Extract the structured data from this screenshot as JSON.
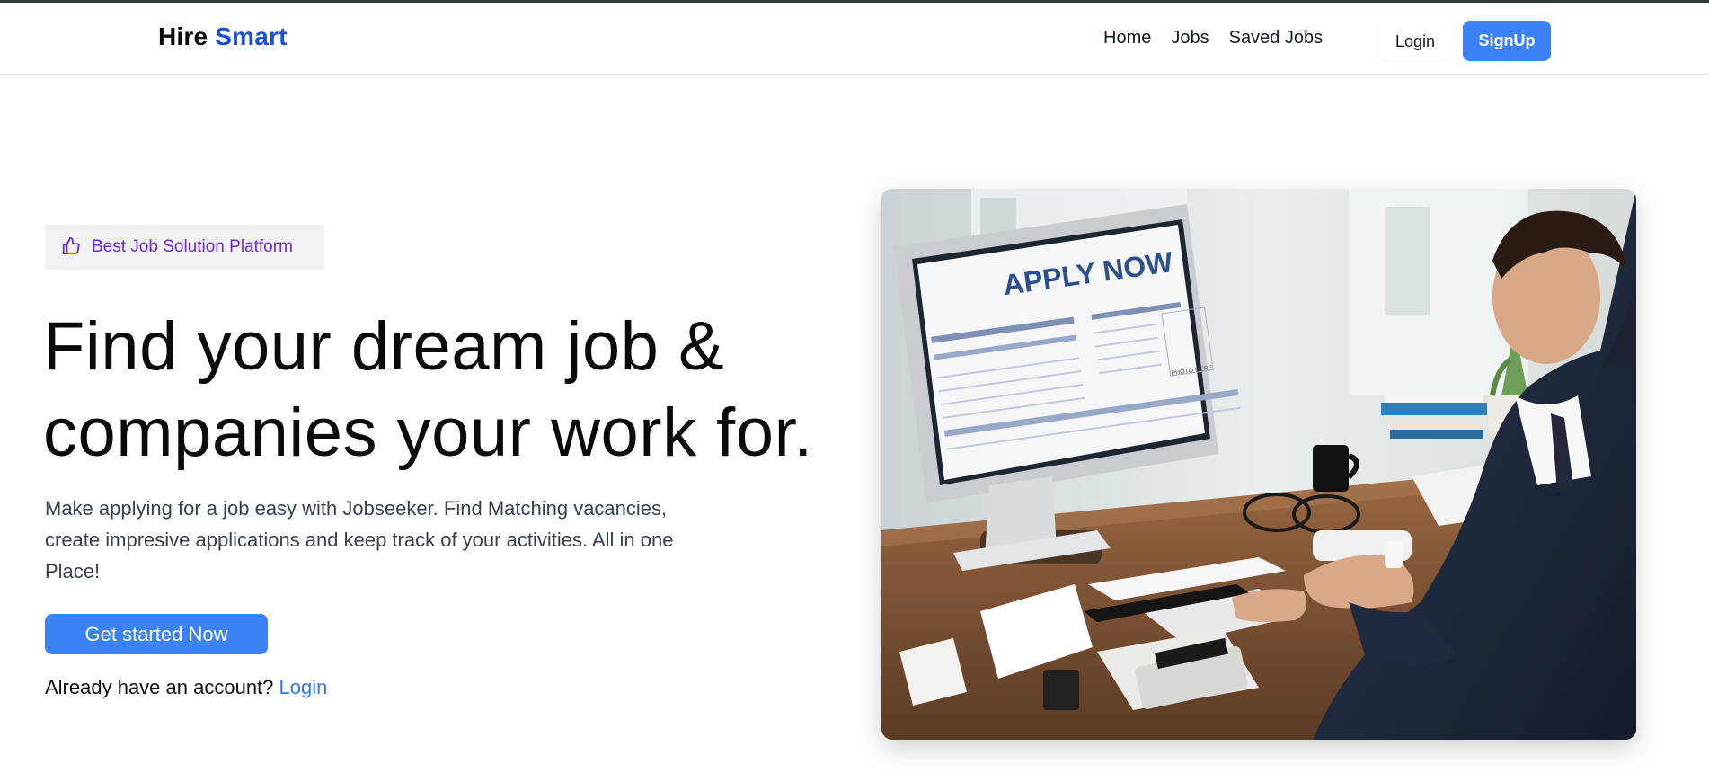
{
  "colors": {
    "brand_accent": "#1d4ed8",
    "primary_button": "#3b82f6",
    "badge_text": "#6d28d9",
    "link": "#2f7bef"
  },
  "navbar": {
    "brand_first": "Hire",
    "brand_second": "Smart",
    "links": [
      "Home",
      "Jobs",
      "Saved Jobs"
    ],
    "login_label": "Login",
    "signup_label": "SignUp"
  },
  "hero": {
    "badge_icon": "thumbs-up-icon",
    "badge_text": "Best Job Solution Platform",
    "headline_line1": "Find your dream job &",
    "headline_line2": "companies your work for.",
    "description_line1": "Make applying for a job easy with Jobseeker. Find Matching vacancies,",
    "description_line2": "create impresive applications and keep track of your activities. All in one",
    "description_line3": "Place!",
    "cta_label": "Get started Now",
    "account_prompt": "Already have an account?",
    "account_link": "Login"
  },
  "image": {
    "screen_heading": "APPLY NOW",
    "photo_label": "PHOTO HERE"
  }
}
